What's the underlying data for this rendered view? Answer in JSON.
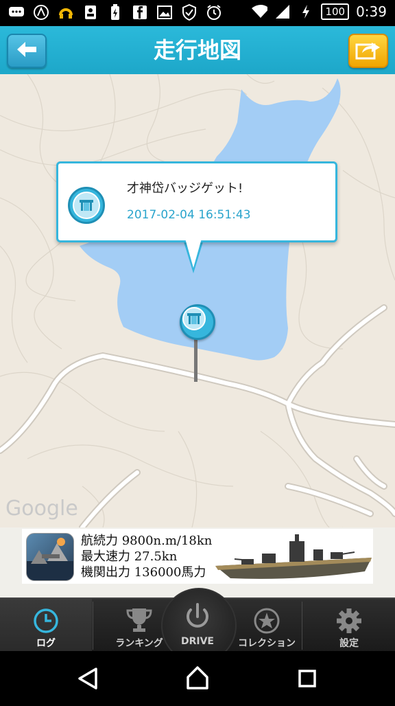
{
  "status_bar": {
    "battery": "100",
    "time": "0:39",
    "left_icons": [
      "message-icon",
      "arc-icon",
      "headphones-icon",
      "contact-icon",
      "battery-saver-icon",
      "facebook-icon",
      "image-icon",
      "shield-icon",
      "alarm-icon"
    ],
    "right_icons": [
      "wifi-icon",
      "signal-icon",
      "charging-icon"
    ]
  },
  "header": {
    "title": "走行地図",
    "back_icon": "back-arrow-icon",
    "share_icon": "share-icon",
    "color": "#1da7c9"
  },
  "map": {
    "watermark": "Google",
    "water_color": "#a3cdf5",
    "land_color": "#efe9df"
  },
  "popup": {
    "title": "才神岱バッジゲット!",
    "timestamp": "2017-02-04 16:51:43",
    "accent": "#36b6dd"
  },
  "ad": {
    "line1": "航続力  9800n.m/18kn",
    "line2": "最大速力  27.5kn",
    "line3": "機関出力  136000馬力"
  },
  "tabs": [
    {
      "label": "ログ",
      "icon": "clock-icon",
      "active": true
    },
    {
      "label": "ランキング",
      "icon": "trophy-icon",
      "active": false
    },
    {
      "label": "DRIVE",
      "icon": "power-icon",
      "active": false
    },
    {
      "label": "コレクション",
      "icon": "star-icon",
      "active": false
    },
    {
      "label": "設定",
      "icon": "gear-icon",
      "active": false
    }
  ],
  "nav": {
    "back_icon": "nav-back-icon",
    "home_icon": "nav-home-icon",
    "recents_icon": "nav-recents-icon"
  }
}
